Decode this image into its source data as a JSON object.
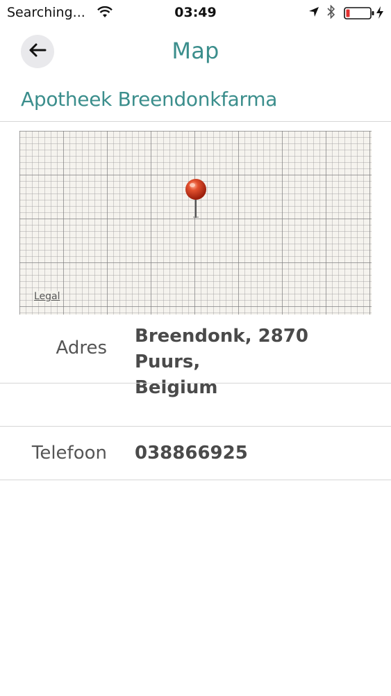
{
  "status_bar": {
    "carrier": "Searching...",
    "time": "03:49"
  },
  "nav": {
    "title": "Map"
  },
  "place": {
    "name": "Apotheek Breendonkfarma"
  },
  "map": {
    "legal_label": "Legal"
  },
  "details": {
    "address_label": "Adres",
    "address_line1": "Breendonk, 2870 Puurs,",
    "address_line2": "Belgium",
    "phone_label": "Telefoon",
    "phone_value": "038866925"
  },
  "colors": {
    "accent": "#3b8e8c",
    "pin": "#d33a1f"
  },
  "icons": [
    "wifi-icon",
    "location-arrow-icon",
    "bluetooth-icon",
    "battery-icon",
    "charging-icon",
    "back-arrow-icon",
    "map-pin-icon"
  ]
}
